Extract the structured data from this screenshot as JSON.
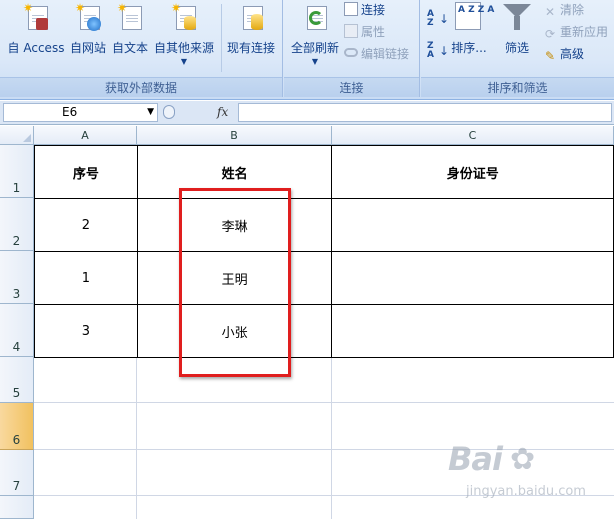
{
  "ribbon": {
    "groups": {
      "external_data": {
        "label": "获取外部数据",
        "buttons": [
          "自 Access",
          "自网站",
          "自文本",
          "自其他来源",
          "现有连接"
        ]
      },
      "connections": {
        "label": "连接",
        "refresh_all": "全部刷新",
        "connections": "连接",
        "properties": "属性",
        "edit_links": "编辑链接"
      },
      "sort_filter": {
        "label": "排序和筛选",
        "sort": "排序...",
        "filter": "筛选",
        "clear": "清除",
        "reapply": "重新应用",
        "advanced": "高级",
        "sort_asc_icon_text": "A Z",
        "sort_dialog_icon_text": "A Z Z A"
      }
    }
  },
  "formula_bar": {
    "name_box": "E6",
    "fx_label": "fx",
    "content": ""
  },
  "sheet": {
    "columns": [
      "A",
      "B",
      "C"
    ],
    "rows": [
      "1",
      "2",
      "3",
      "4",
      "5",
      "6",
      "7"
    ],
    "active_row": "6",
    "table": {
      "headers": [
        "序号",
        "姓名",
        "身份证号"
      ],
      "rows": [
        [
          "2",
          "李琳",
          ""
        ],
        [
          "1",
          "王明",
          ""
        ],
        [
          "3",
          "小张",
          ""
        ]
      ]
    }
  },
  "watermark": {
    "brand": "Bai",
    "sub": "jingyan.baidu.com"
  },
  "colors": {
    "ribbon_bg": "#dbe8f8",
    "group_label_text": "#3e5f93",
    "highlight_border": "#e01e1e",
    "active_row_header": "#f1c15f"
  }
}
